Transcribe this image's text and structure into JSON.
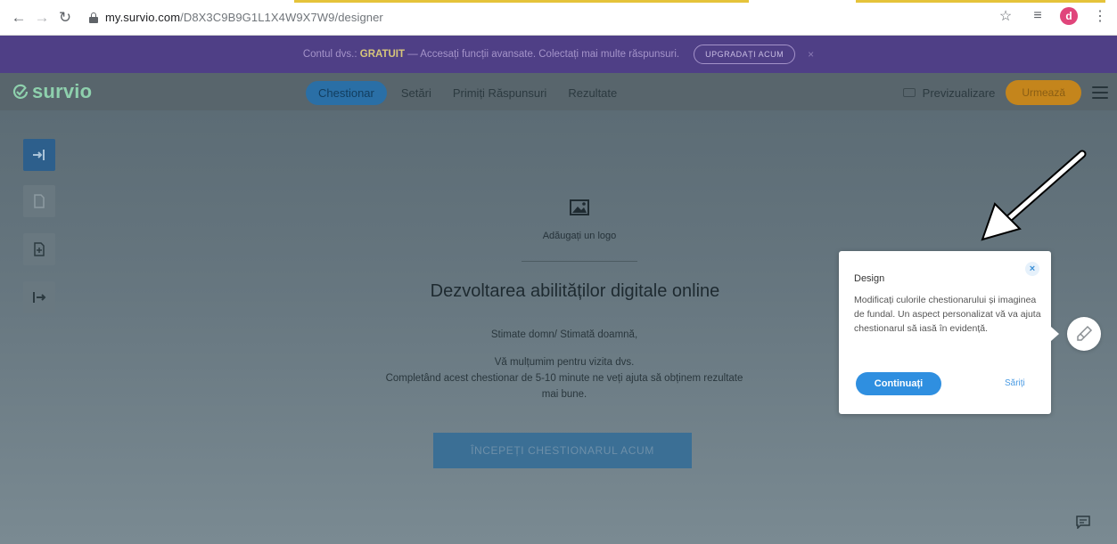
{
  "browser": {
    "url_host": "my.survio.com",
    "url_path": "/D8X3C9B9G1L1X4W9X7W9/designer",
    "avatar_letter": "d",
    "icons": [
      "back-arrow-icon",
      "forward-arrow-icon",
      "reload-icon",
      "lock-icon",
      "star-icon",
      "playlist-icon",
      "kebab-menu-icon"
    ]
  },
  "promo": {
    "prefix": "Contul dvs.:",
    "plan": "GRATUIT",
    "message": "— Accesați funcții avansate. Colectați mai multe răspunsuri.",
    "button": "UPGRADAȚI ACUM",
    "close": "×"
  },
  "header": {
    "logo": "survio",
    "tabs": [
      {
        "label": "Chestionar",
        "active": true
      },
      {
        "label": "Setări",
        "active": false
      },
      {
        "label": "Primiți Răspunsuri",
        "active": false
      },
      {
        "label": "Rezultate",
        "active": false
      }
    ],
    "preview": "Previzualizare",
    "publish": "Urmează"
  },
  "sidebar": {
    "tools": [
      {
        "name": "intro-page",
        "icon": "arrow-into-icon",
        "active": true
      },
      {
        "name": "blank-page",
        "icon": "page-icon",
        "active": false
      },
      {
        "name": "add-page",
        "icon": "page-add-icon",
        "active": false
      },
      {
        "name": "end-page",
        "icon": "exit-arrow-icon",
        "active": false
      }
    ]
  },
  "survey": {
    "logo_placeholder": "Adăugați un logo",
    "title": "Dezvoltarea abilităților digitale online",
    "greeting": "Stimate domn/ Stimată doamnă,",
    "thanks": "Vă mulțumim pentru vizita dvs.",
    "intro_line1": "Completând acest chestionar de 5-10 minute ne veți ajuta să obținem rezultate",
    "intro_line2": "mai bune.",
    "start_button": "ÎNCEPEȚI CHESTIONARUL ACUM"
  },
  "tooltip": {
    "title": "Design",
    "close": "×",
    "body": "Modificați culorile chestionarului și imaginea de fundal. Un aspect personalizat vă va ajuta chestionarul să iasă în evidență.",
    "continue": "Continuați",
    "skip": "Săriți"
  },
  "colors": {
    "promo_bg": "#4f3f86",
    "header_bg": "#58656c",
    "active_tab": "#2a6fa6",
    "publish": "#c4851c",
    "start_button": "#3b6f95",
    "tooltip_primary": "#2f8fe0",
    "logo": "#8ed0ad"
  }
}
